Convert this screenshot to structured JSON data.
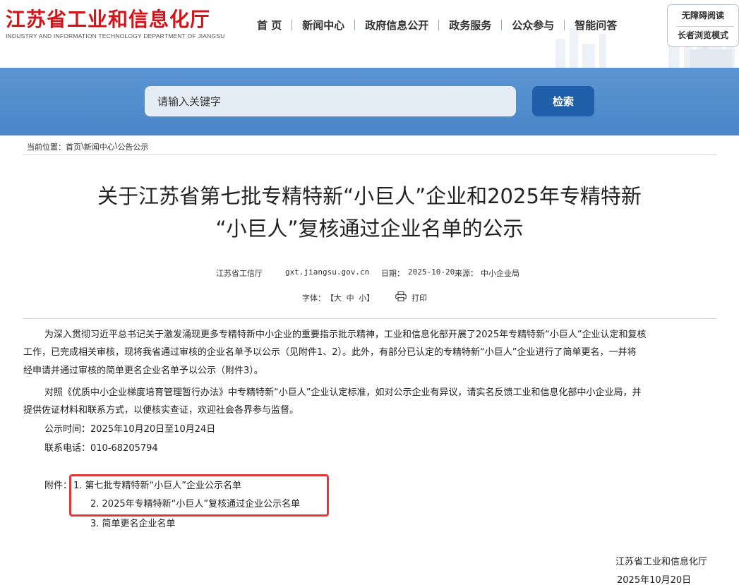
{
  "site": {
    "name_cn": "江苏省工业和信息化厅",
    "name_en": "INDUSTRY AND INFORMATION TECHNOLOGY DEPARTMENT OF JIANGSU",
    "brand_color": "#d2151a"
  },
  "nav": {
    "items": [
      {
        "label": "首 页"
      },
      {
        "label": "新闻中心"
      },
      {
        "label": "政府信息公开"
      },
      {
        "label": "政务服务"
      },
      {
        "label": "公众参与"
      },
      {
        "label": "智能问答"
      }
    ]
  },
  "accessibility": {
    "barrier_free": "无障碍阅读",
    "elder_mode": "长者浏览模式"
  },
  "search": {
    "placeholder": "请输入关键字",
    "button": "检索",
    "band_color": "#4f8bcc",
    "button_color": "#1f5ea8"
  },
  "breadcrumb": {
    "prefix": "当前位置：",
    "items": [
      "首页",
      "新闻中心",
      "公告公示"
    ],
    "separator": "\\"
  },
  "article": {
    "title_line1": "关于江苏省第七批专精特新“小巨人”企业和2025年专精特新",
    "title_line2": "“小巨人”复核通过企业名单的公示",
    "publisher": "江苏省工信厅",
    "site_url": "gxt.jiangsu.gov.cn",
    "date_label": "日期：",
    "date": "2025-10-20",
    "source_label": "来源：",
    "source": "中小企业局",
    "font_label": "字体：",
    "font_sizes": "【大 中 小】",
    "print_label": "打印",
    "paragraphs": [
      "为深入贯彻习近平总书记关于激发涌现更多专精特新中小企业的重要指示批示精神，工业和信息化部开展了2025年专精特新“小巨人”企业认定和复核",
      "工作，已完成相关审核，现将我省通过审核的企业名单予以公示（见附件1、2）。此外，有部分已认定的专精特新“小巨人”企业进行了简单更名，一并将",
      "经申请并通过审核的简单更名企业名单予以公示（附件3）。",
      "对照《优质中小企业梯度培育管理暂行办法》中专精特新“小巨人”企业认定标准，如对公示企业有异议，请实名反馈工业和信息化部中小企业局，并",
      "提供佐证材料和联系方式，以便核实查证，欢迎社会各界参与监督。",
      "公示时间：2025年10月20日至10月24日",
      "联系电话：010-68205794"
    ],
    "attachments_label": "附件：",
    "attachments": [
      "1. 第七批专精特新“小巨人”企业公示名单",
      "2. 2025年专精特新“小巨人”复核通过企业公示名单",
      "3. 简单更名企业名单"
    ],
    "signature": "江苏省工业和信息化厅",
    "sign_date": "2025年10月20日",
    "highlight_color": "#e0393a"
  }
}
